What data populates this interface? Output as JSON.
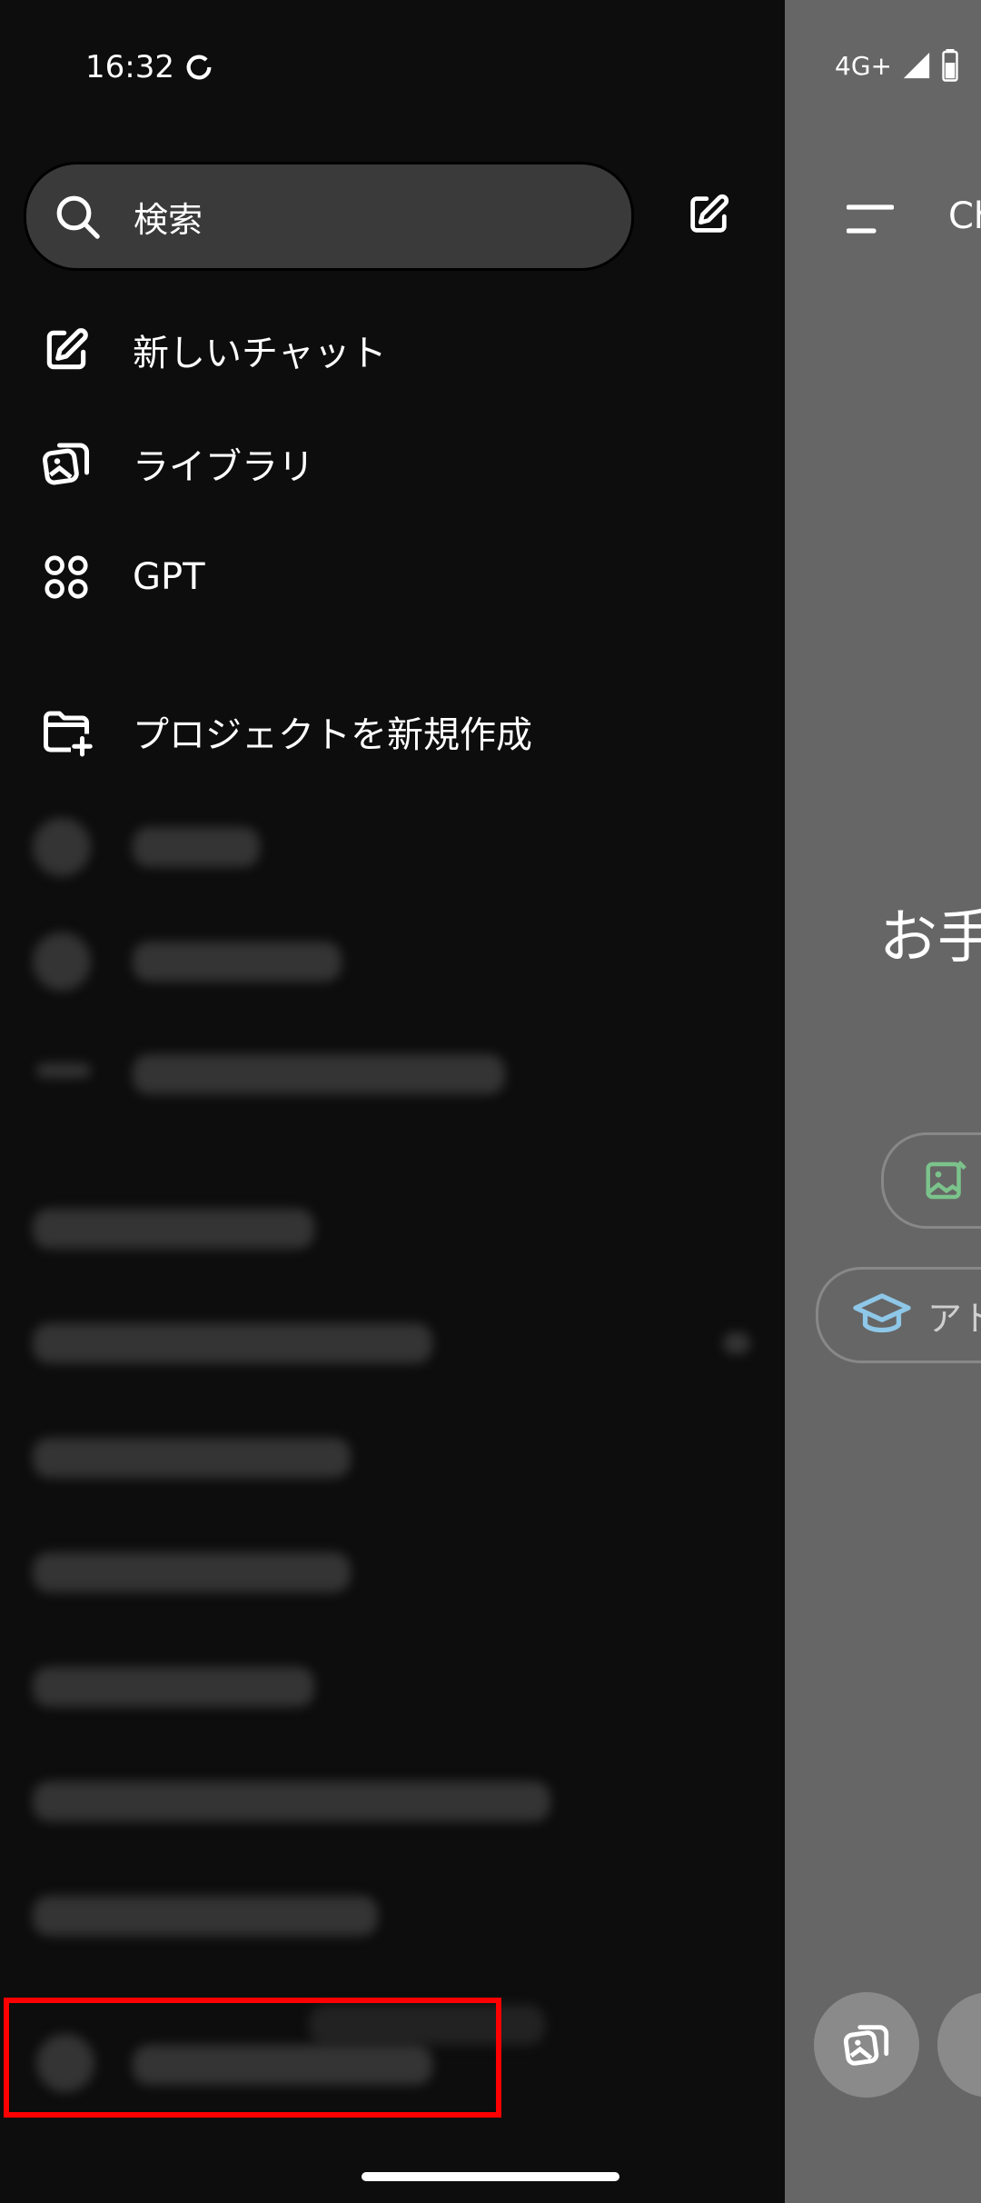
{
  "status": {
    "time": "16:32",
    "network": "4G+"
  },
  "drawer": {
    "search": {
      "placeholder": "検索"
    },
    "menu": [
      {
        "label": "新しいチャット",
        "icon": "edit-icon"
      },
      {
        "label": "ライブラリ",
        "icon": "image-stack-icon"
      },
      {
        "label": "GPT",
        "icon": "grid-dots-icon"
      },
      {
        "label": "プロジェクトを新規作成",
        "icon": "folder-plus-icon"
      }
    ]
  },
  "main": {
    "title": "Ch",
    "heading": "お手",
    "pill_2_label": "アト"
  },
  "colors": {
    "drawer_bg": "#0d0d0d",
    "main_bg": "#666666",
    "highlight": "#ff0000",
    "green_icon": "#7bc38b",
    "blue_icon": "#8ec7e8"
  }
}
